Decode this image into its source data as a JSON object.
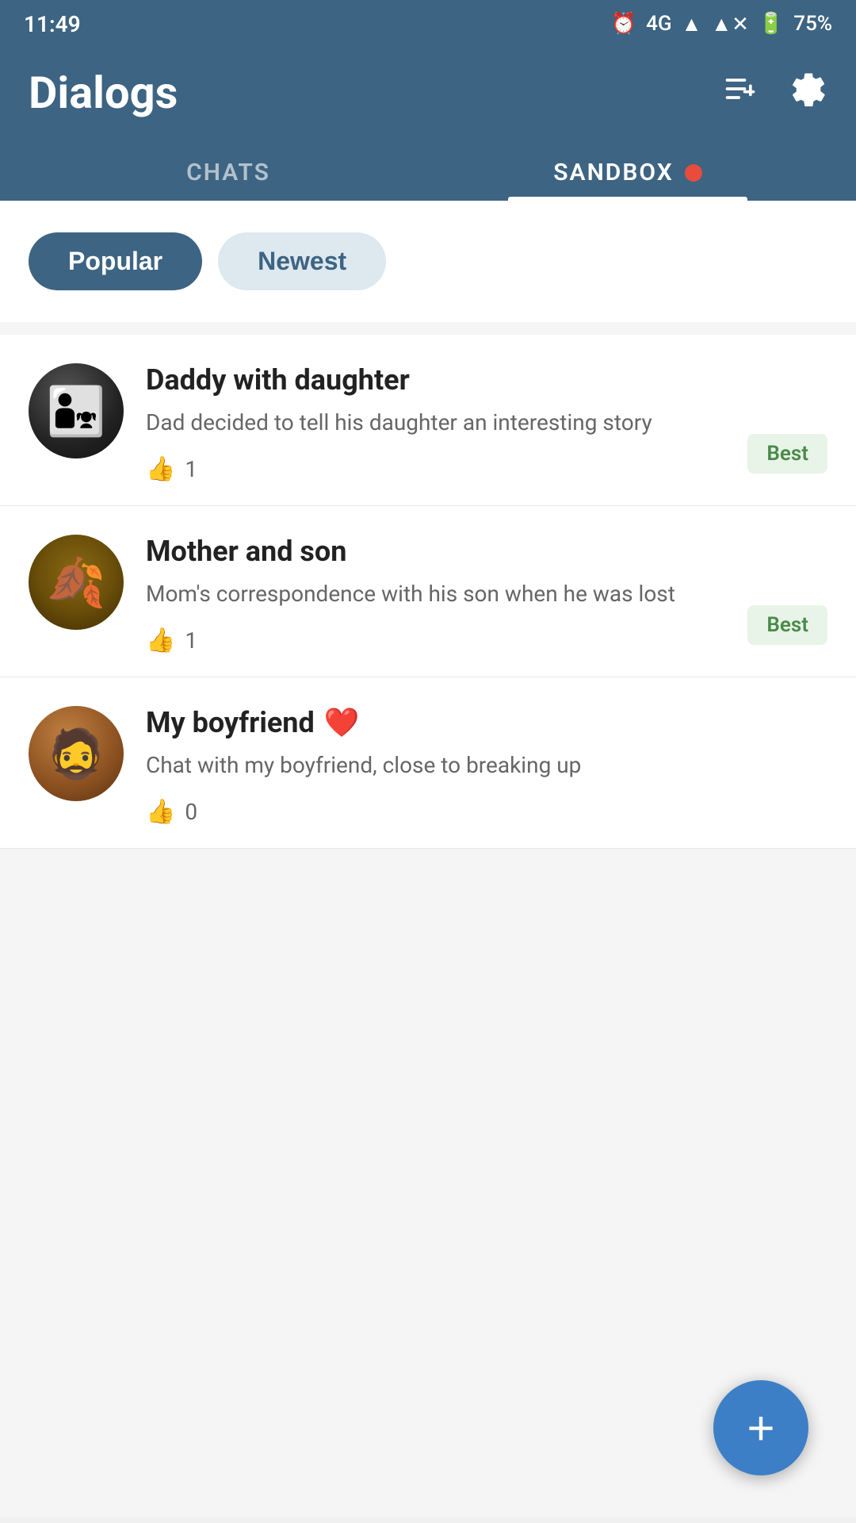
{
  "statusBar": {
    "time": "11:49",
    "network": "4G",
    "battery": "75%"
  },
  "header": {
    "title": "Dialogs",
    "addListIcon": "≡+",
    "settingsIcon": "⚙"
  },
  "tabs": [
    {
      "id": "chats",
      "label": "CHATS",
      "active": false
    },
    {
      "id": "sandbox",
      "label": "SANDBOX",
      "active": true,
      "hasDot": true
    }
  ],
  "filters": [
    {
      "id": "popular",
      "label": "Popular",
      "active": true
    },
    {
      "id": "newest",
      "label": "Newest",
      "active": false
    }
  ],
  "chatList": [
    {
      "id": "daddy-daughter",
      "name": "Daddy with daughter",
      "description": "Dad decided to tell his daughter an interesting story",
      "likes": 1,
      "hasBest": true,
      "avatarType": "daddy"
    },
    {
      "id": "mother-son",
      "name": "Mother and son",
      "description": "Mom's correspondence with his son when he was lost",
      "likes": 1,
      "hasBest": true,
      "avatarType": "mother"
    },
    {
      "id": "my-boyfriend",
      "name": "My boyfriend",
      "nameEmoji": "❤️",
      "description": "Chat with my boyfriend, close to breaking up",
      "likes": 0,
      "hasBest": false,
      "avatarType": "boyfriend"
    }
  ],
  "fab": {
    "label": "+"
  },
  "badges": {
    "best": "Best"
  }
}
